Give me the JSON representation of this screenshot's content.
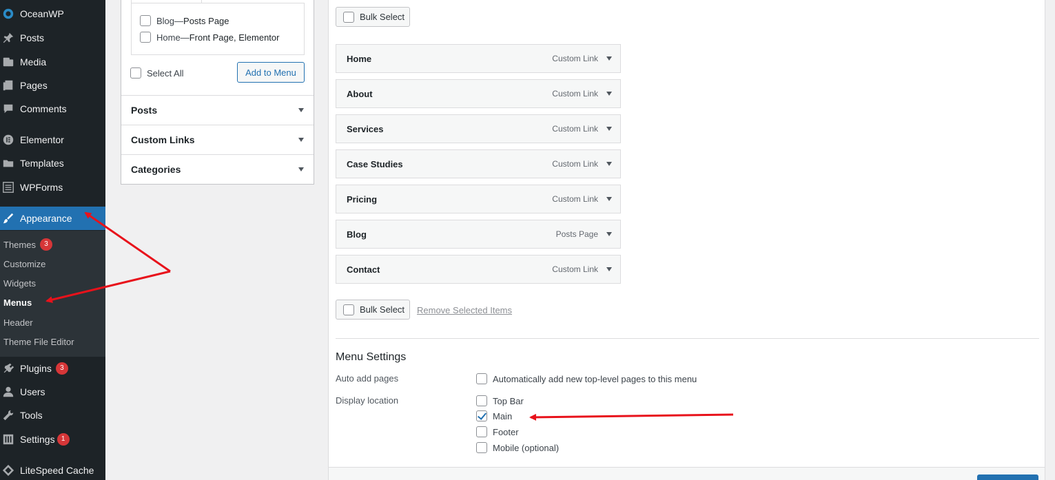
{
  "sidebar": {
    "items": [
      {
        "label": "OceanWP",
        "icon": "oceanwp-icon"
      },
      {
        "label": "Posts",
        "icon": "pin-icon"
      },
      {
        "label": "Media",
        "icon": "media-icon"
      },
      {
        "label": "Pages",
        "icon": "pages-icon"
      },
      {
        "label": "Comments",
        "icon": "comment-icon"
      },
      {
        "label": "Elementor",
        "icon": "elementor-icon"
      },
      {
        "label": "Templates",
        "icon": "folder-icon"
      },
      {
        "label": "WPForms",
        "icon": "form-icon"
      },
      {
        "label": "Appearance",
        "icon": "brush-icon"
      },
      {
        "label": "Plugins",
        "icon": "plugin-icon",
        "badge": "3"
      },
      {
        "label": "Users",
        "icon": "user-icon"
      },
      {
        "label": "Tools",
        "icon": "wrench-icon"
      },
      {
        "label": "Settings",
        "icon": "settings-icon",
        "badge": "1"
      },
      {
        "label": "LiteSpeed Cache",
        "icon": "diamond-icon"
      }
    ],
    "submenu": [
      {
        "label": "Themes",
        "badge": "3"
      },
      {
        "label": "Customize"
      },
      {
        "label": "Widgets"
      },
      {
        "label": "Menus"
      },
      {
        "label": "Header"
      },
      {
        "label": "Theme File Editor"
      }
    ]
  },
  "add_items": {
    "pages": [
      {
        "name": "Blog",
        "sep": " — ",
        "state": "Posts Page"
      },
      {
        "name": "Home",
        "sep": " — ",
        "state": "Front Page, Elementor"
      }
    ],
    "select_all": "Select All",
    "add_button": "Add to Menu",
    "sections": [
      "Posts",
      "Custom Links",
      "Categories"
    ]
  },
  "menu_structure": {
    "bulk_select": "Bulk Select",
    "items": [
      {
        "title": "Home",
        "type": "Custom Link"
      },
      {
        "title": "About",
        "type": "Custom Link"
      },
      {
        "title": "Services",
        "type": "Custom Link"
      },
      {
        "title": "Case Studies",
        "type": "Custom Link"
      },
      {
        "title": "Pricing",
        "type": "Custom Link"
      },
      {
        "title": "Blog",
        "type": "Posts Page"
      },
      {
        "title": "Contact",
        "type": "Custom Link"
      }
    ],
    "remove_selected": "Remove Selected Items"
  },
  "menu_settings": {
    "title": "Menu Settings",
    "auto_add_label": "Auto add pages",
    "auto_add_option": "Automatically add new top-level pages to this menu",
    "display_location_label": "Display location",
    "locations": [
      {
        "label": "Top Bar",
        "checked": false
      },
      {
        "label": "Main",
        "checked": true
      },
      {
        "label": "Footer",
        "checked": false
      },
      {
        "label": "Mobile (optional)",
        "checked": false
      }
    ]
  },
  "colors": {
    "sidebar_bg": "#1d2327",
    "accent": "#2271b1",
    "badge": "#d63638",
    "annotation_arrow": "#e8121b"
  }
}
